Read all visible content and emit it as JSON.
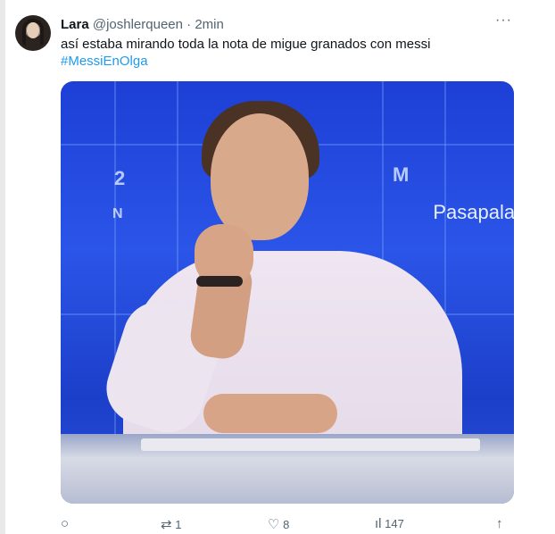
{
  "tweet": {
    "author_name": "Lara",
    "handle": "@joshlerqueen",
    "separator": "·",
    "time": "2min",
    "text": "así estaba mirando toda la nota de migue granados con messi",
    "hashtag": "#MessiEnOlga",
    "more_icon": "more-horizontal-icon",
    "more_glyph": "···"
  },
  "media": {
    "overlay_text": "Pasapalal",
    "glyphs": [
      "2",
      "M",
      "N"
    ]
  },
  "actions": {
    "reply": {
      "icon": "reply-icon",
      "glyph": "○",
      "count": ""
    },
    "retweet": {
      "icon": "retweet-icon",
      "glyph": "⇄",
      "count": "1"
    },
    "like": {
      "icon": "like-icon",
      "glyph": "♡",
      "count": "8"
    },
    "views": {
      "icon": "views-icon",
      "glyph": "ıl",
      "count": "147"
    },
    "share": {
      "icon": "share-icon",
      "glyph": "↑",
      "count": ""
    }
  },
  "colors": {
    "link": "#1d9bf0",
    "secondary_text": "#536471",
    "primary_text": "#0f1419",
    "media_blue": "#2b55e8"
  }
}
